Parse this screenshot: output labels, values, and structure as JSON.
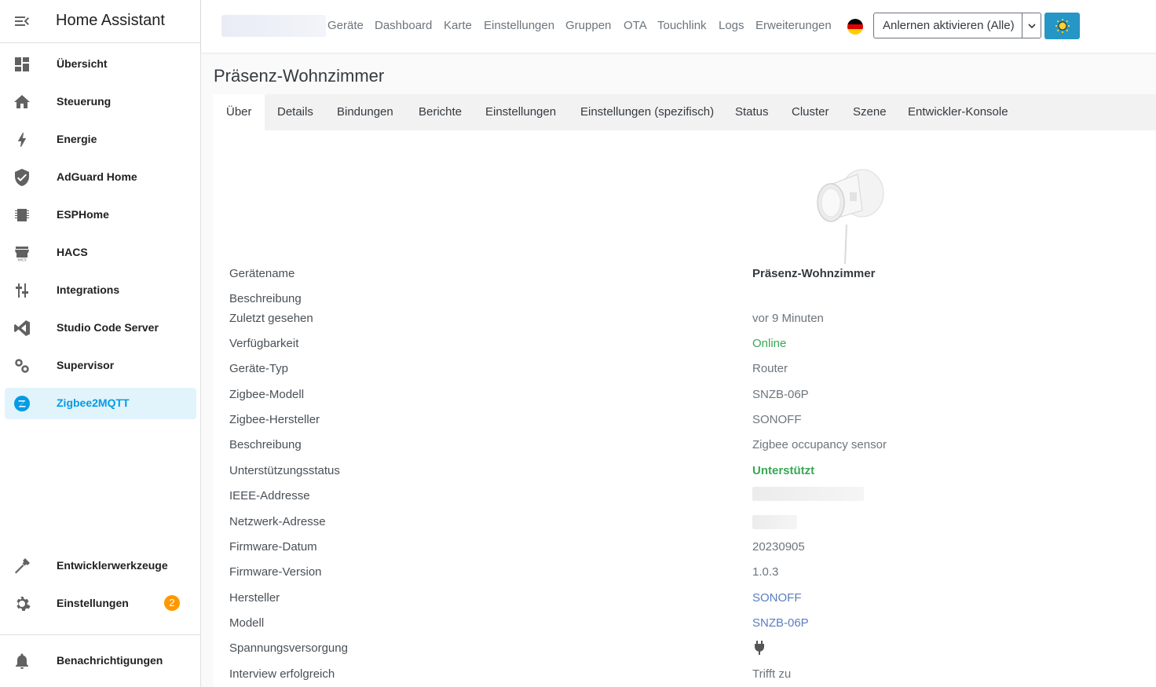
{
  "sidebar": {
    "title": "Home Assistant",
    "items": [
      {
        "label": "Übersicht",
        "icon": "dashboard-icon"
      },
      {
        "label": "Steuerung",
        "icon": "home-icon"
      },
      {
        "label": "Energie",
        "icon": "lightning-icon"
      },
      {
        "label": "AdGuard Home",
        "icon": "shield-check-icon"
      },
      {
        "label": "ESPHome",
        "icon": "chip-icon"
      },
      {
        "label": "HACS",
        "icon": "hacs-store-icon"
      },
      {
        "label": "Integrations",
        "icon": "sliders-icon"
      },
      {
        "label": "Studio Code Server",
        "icon": "vscode-icon"
      },
      {
        "label": "Supervisor",
        "icon": "cogs-icon"
      },
      {
        "label": "Zigbee2MQTT",
        "icon": "zigbee-icon",
        "active": true
      }
    ],
    "bottom_items": [
      {
        "label": "Entwicklerwerkzeuge",
        "icon": "hammer-icon"
      },
      {
        "label": "Einstellungen",
        "icon": "gear-icon",
        "badge": "2"
      },
      {
        "label": "Benachrichtigungen",
        "icon": "bell-icon"
      }
    ]
  },
  "topbar": {
    "nav": [
      "Geräte",
      "Dashboard",
      "Karte",
      "Einstellungen",
      "Gruppen",
      "OTA",
      "Touchlink",
      "Logs",
      "Erweiterungen"
    ],
    "language_flag": "flag-de-icon",
    "permit_join_label": "Anlernen aktivieren (Alle)",
    "theme_icon": "sun-icon"
  },
  "page": {
    "title": "Präsenz-Wohnzimmer",
    "tabs": [
      "Über",
      "Details",
      "Bindungen",
      "Berichte",
      "Einstellungen",
      "Einstellungen (spezifisch)",
      "Status",
      "Cluster",
      "Szene",
      "Entwickler-Konsole"
    ],
    "active_tab": "Über"
  },
  "device": {
    "rows": [
      {
        "label": "Gerätename",
        "value": "Präsenz-Wohnzimmer"
      },
      {
        "label": "Beschreibung",
        "value": ""
      },
      {
        "label": "Zuletzt gesehen",
        "value": "vor 9 Minuten"
      },
      {
        "label": "Verfügbarkeit",
        "value": "Online"
      },
      {
        "label": "Geräte-Typ",
        "value": "Router"
      },
      {
        "label": "Zigbee-Modell",
        "value": "SNZB-06P"
      },
      {
        "label": "Zigbee-Hersteller",
        "value": "SONOFF"
      },
      {
        "label": "Beschreibung",
        "value": "Zigbee occupancy sensor"
      },
      {
        "label": "Unterstützungsstatus",
        "value": "Unterstützt"
      },
      {
        "label": "IEEE-Addresse",
        "value": ""
      },
      {
        "label": "Netzwerk-Adresse",
        "value": ""
      },
      {
        "label": "Firmware-Datum",
        "value": "20230905"
      },
      {
        "label": "Firmware-Version",
        "value": "1.0.3"
      },
      {
        "label": "Hersteller",
        "value": "SONOFF"
      },
      {
        "label": "Modell",
        "value": "SNZB-06P"
      },
      {
        "label": "Spannungsversorgung",
        "value": "",
        "icon": "power-plug-icon"
      },
      {
        "label": "Interview erfolgreich",
        "value": "Trifft zu"
      }
    ]
  },
  "colors": {
    "accent": "#039be5",
    "active_bg": "#e1f3fb",
    "badge": "#ff9800",
    "online": "#3aa757",
    "link": "#5b7dbf",
    "theme_button": "#2596c6"
  }
}
